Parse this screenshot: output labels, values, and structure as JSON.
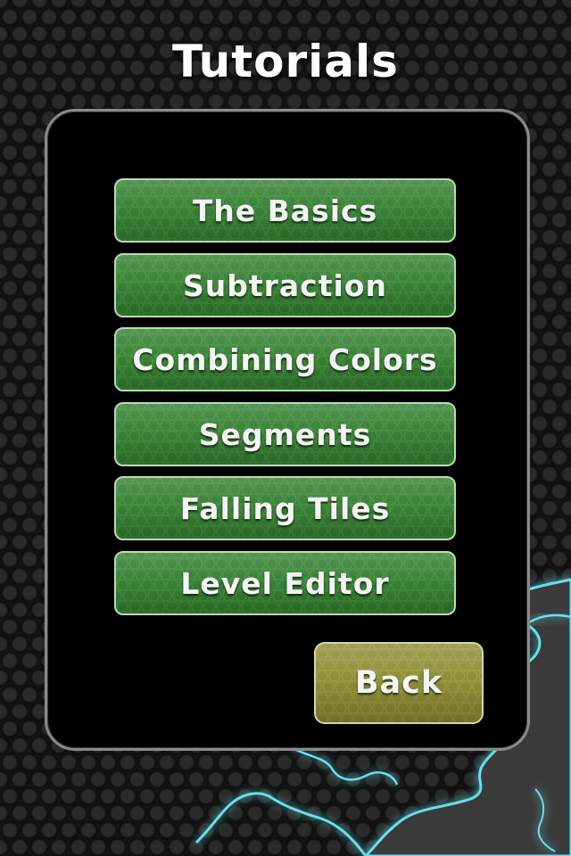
{
  "screen": {
    "title": "Tutorials"
  },
  "menu": {
    "items": [
      {
        "label": "The Basics"
      },
      {
        "label": "Subtraction"
      },
      {
        "label": "Combining Colors"
      },
      {
        "label": "Segments"
      },
      {
        "label": "Falling Tiles"
      },
      {
        "label": "Level Editor"
      }
    ]
  },
  "back_button": {
    "label": "Back"
  },
  "colors": {
    "menu_button": "#2f7c2c",
    "back_button": "#8a8a30",
    "glow": "#5fd6e0",
    "background": "#141414"
  },
  "decoration": {
    "icon": "electric-splash"
  }
}
